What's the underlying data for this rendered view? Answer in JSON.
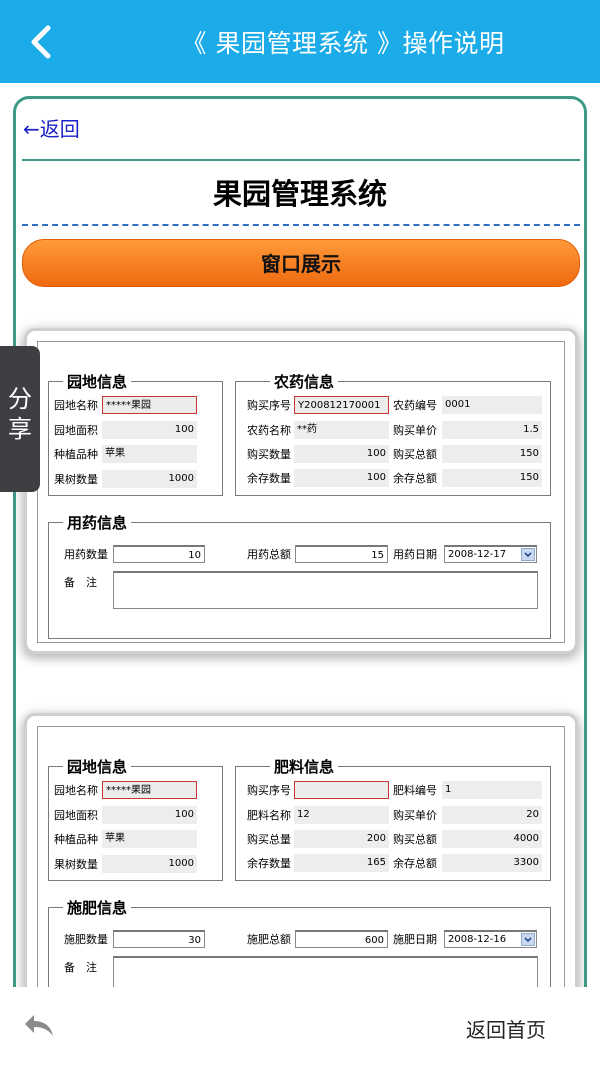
{
  "header": {
    "title": "《 果园管理系统 》操作说明"
  },
  "content": {
    "return_link": "←返回",
    "page_title": "果园管理系统",
    "section_button": "窗口展示"
  },
  "share_tab": {
    "char1": "分",
    "char2": "享"
  },
  "bottom": {
    "home_label": "返回首页"
  },
  "window1": {
    "garden": {
      "legend": "园地信息",
      "name_label": "园地名称",
      "name_value": "*****果园",
      "area_label": "园地面积",
      "area_value": "100",
      "variety_label": "种植品种",
      "variety_value": "苹果",
      "trees_label": "果树数量",
      "trees_value": "1000"
    },
    "pesticide": {
      "legend": "农药信息",
      "seq_label": "购买序号",
      "seq_value": "Y200812170001",
      "code_label": "农药编号",
      "code_value": "0001",
      "name_label": "农药名称",
      "name_value": "**药",
      "price_label": "购买单价",
      "price_value": "1.5",
      "qty_label": "购买数量",
      "qty_value": "100",
      "total_label": "购买总额",
      "total_value": "150",
      "rem_qty_label": "余存数量",
      "rem_qty_value": "100",
      "rem_total_label": "余存总额",
      "rem_total_value": "150"
    },
    "usage": {
      "legend": "用药信息",
      "qty_label": "用药数量",
      "qty_value": "10",
      "total_label": "用药总额",
      "total_value": "15",
      "date_label": "用药日期",
      "date_value": "2008-12-17",
      "note_label": "备　注"
    }
  },
  "window2": {
    "garden": {
      "legend": "园地信息",
      "name_label": "园地名称",
      "name_value": "*****果园",
      "area_label": "园地面积",
      "area_value": "100",
      "variety_label": "种植品种",
      "variety_value": "苹果",
      "trees_label": "果树数量",
      "trees_value": "1000"
    },
    "fertilizer": {
      "legend": "肥料信息",
      "seq_label": "购买序号",
      "seq_value": "",
      "code_label": "肥料编号",
      "code_value": "1",
      "name_label": "肥料名称",
      "name_value": "12",
      "price_label": "购买单价",
      "price_value": "20",
      "qty_label": "购买总量",
      "qty_value": "200",
      "total_label": "购买总额",
      "total_value": "4000",
      "rem_qty_label": "余存数量",
      "rem_qty_value": "165",
      "rem_total_label": "余存总额",
      "rem_total_value": "3300"
    },
    "usage": {
      "legend": "施肥信息",
      "qty_label": "施肥数量",
      "qty_value": "30",
      "total_label": "施肥总额",
      "total_value": "600",
      "date_label": "施肥日期",
      "date_value": "2008-12-16",
      "note_label": "备　注"
    }
  },
  "colors": {
    "topbar": "#1aabe8",
    "frame_border": "#3c9987",
    "button_orange": "#f27618",
    "link_blue": "#1b22c8"
  }
}
